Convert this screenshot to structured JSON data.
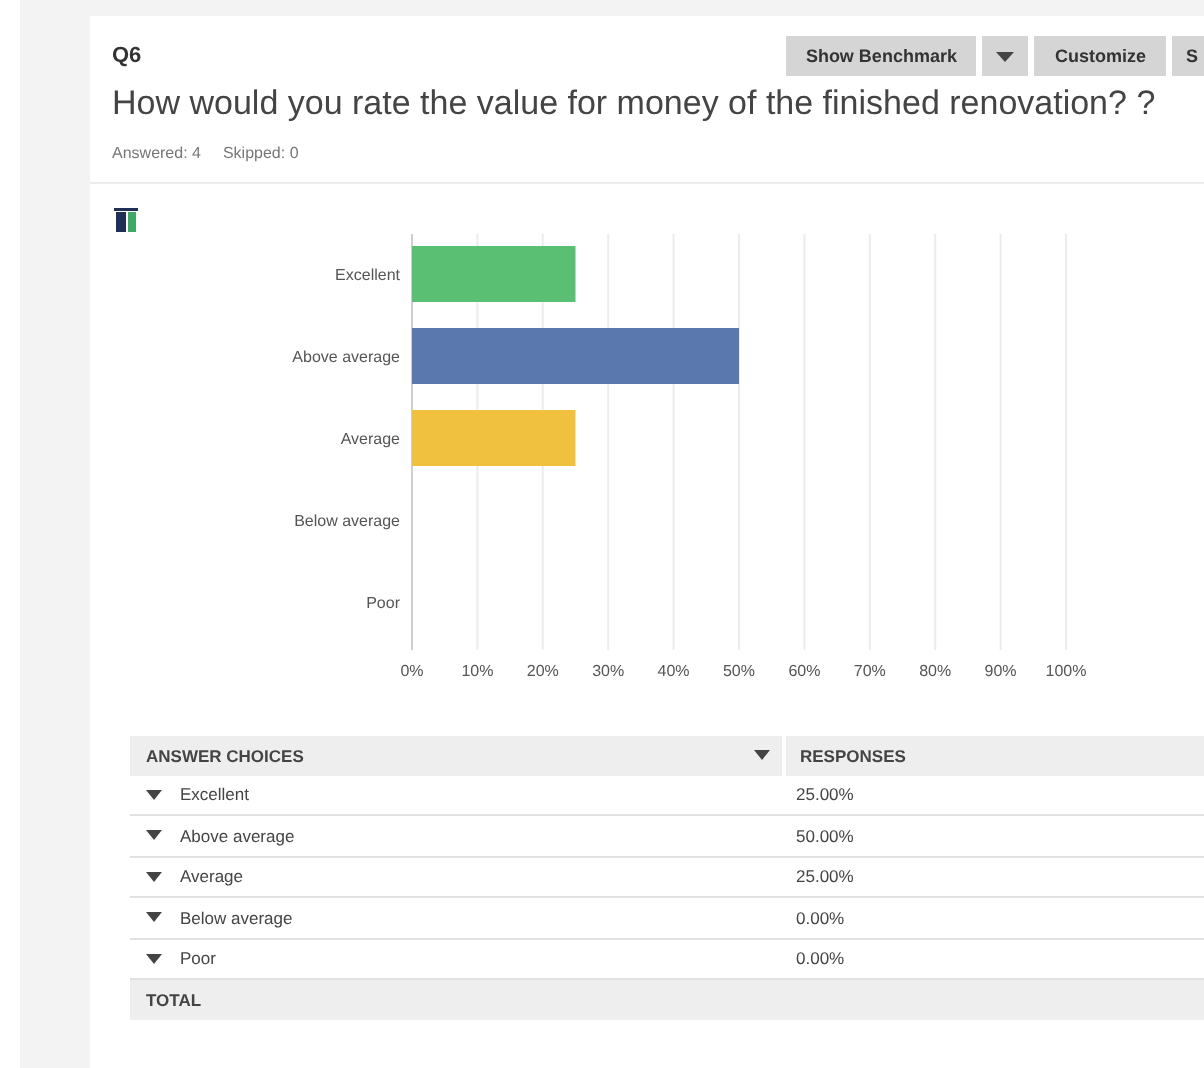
{
  "question": {
    "number": "Q6",
    "title": "How would you rate the value for money of the finished renovation? ?",
    "answered": "Answered: 4",
    "skipped": "Skipped: 0"
  },
  "buttons": [
    {
      "label": "Show Benchmark",
      "kind": "text"
    },
    {
      "kind": "caret"
    },
    {
      "label": "Customize",
      "kind": "text"
    },
    {
      "label": "S",
      "kind": "text"
    }
  ],
  "chart": {
    "chart_data": {
      "type": "bar",
      "orientation": "horizontal",
      "categories": [
        "Excellent",
        "Above average",
        "Average",
        "Below average",
        "Poor"
      ],
      "series": [
        {
          "values": [
            25,
            50,
            25,
            0,
            0
          ]
        }
      ],
      "colors": [
        "#5bbf73",
        "#5a78ae",
        "#f0c13f"
      ],
      "grid": true,
      "xlim": [
        0,
        100
      ],
      "xticks": [
        {
          "value": 0,
          "label": "0%"
        },
        {
          "value": 10,
          "label": "10%"
        },
        {
          "value": 20,
          "label": "20%"
        },
        {
          "value": 30,
          "label": "30%"
        },
        {
          "value": 40,
          "label": "40%"
        },
        {
          "value": 50,
          "label": "50%"
        },
        {
          "value": 60,
          "label": "60%"
        },
        {
          "value": 70,
          "label": "70%"
        },
        {
          "value": 80,
          "label": "80%"
        },
        {
          "value": 90,
          "label": "90%"
        },
        {
          "value": 100,
          "label": "100%"
        }
      ]
    }
  },
  "table": {
    "columns": [
      "ANSWER CHOICES",
      "RESPONSES"
    ],
    "rows": [
      {
        "choice": "Excellent",
        "response": "25.00%"
      },
      {
        "choice": "Above average",
        "response": "50.00%"
      },
      {
        "choice": "Average",
        "response": "25.00%"
      },
      {
        "choice": "Below average",
        "response": "0.00%"
      },
      {
        "choice": "Poor",
        "response": "0.00%"
      }
    ],
    "total": "TOTAL"
  }
}
